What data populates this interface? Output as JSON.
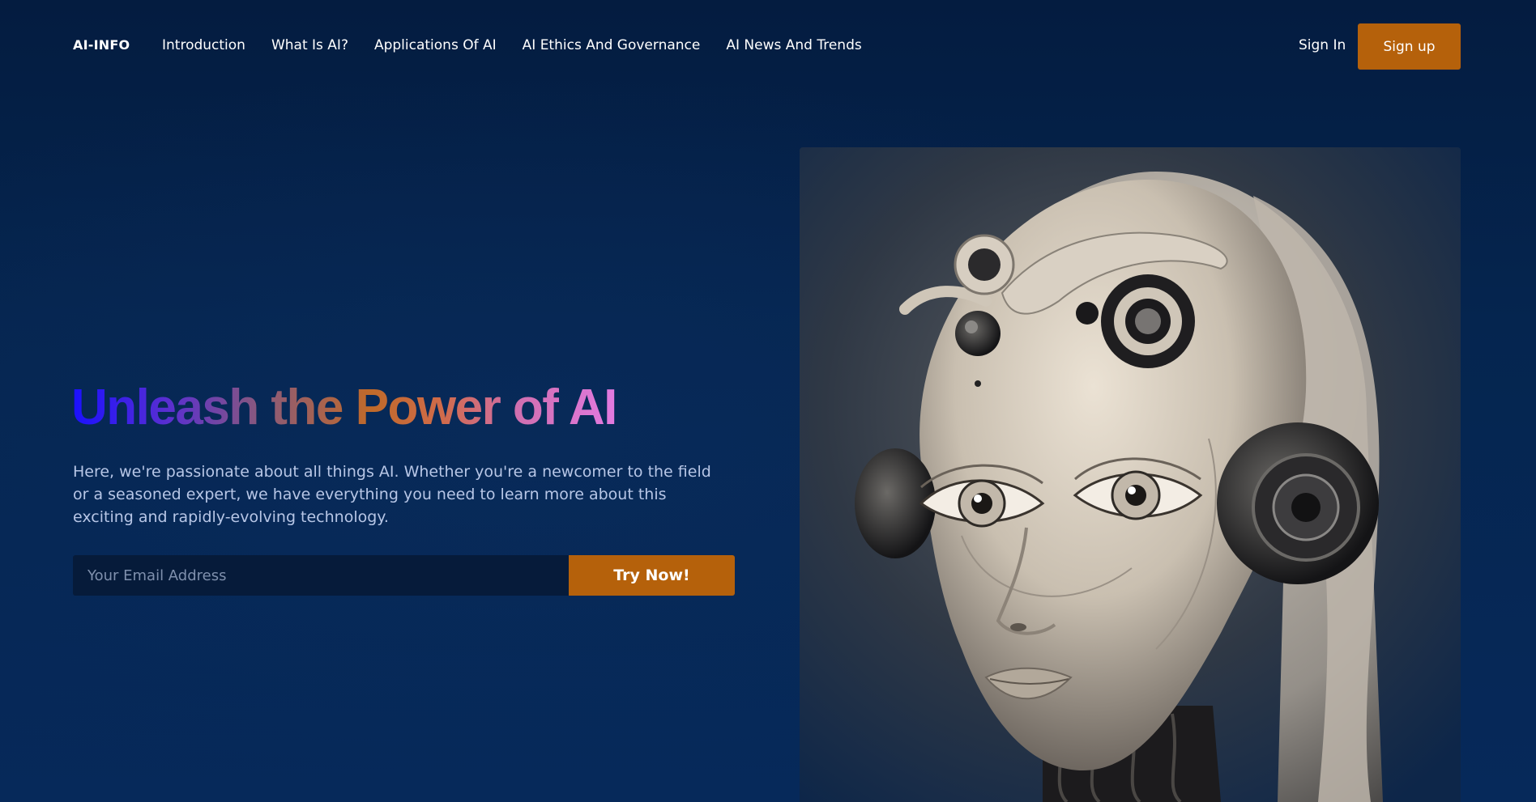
{
  "brand": {
    "logo": "AI-INFO"
  },
  "nav": {
    "links": [
      "Introduction",
      "What Is AI?",
      "Applications Of AI",
      "AI Ethics And Governance",
      "AI News And Trends"
    ],
    "sign_in": "Sign In",
    "sign_up": "Sign up"
  },
  "hero": {
    "title": "Unleash the Power of AI",
    "description": "Here, we're passionate about all things AI. Whether you're a newcomer to the field or a seasoned expert, we have everything you need to learn more about this exciting and rapidly-evolving technology.",
    "email_placeholder": "Your Email Address",
    "cta": "Try Now!"
  },
  "colors": {
    "background": "#042149",
    "accent": "#b5610b",
    "body_text": "#b7c6e6",
    "input_bg": "#061b3a"
  },
  "images": {
    "hero": "robot-face-illustration"
  }
}
